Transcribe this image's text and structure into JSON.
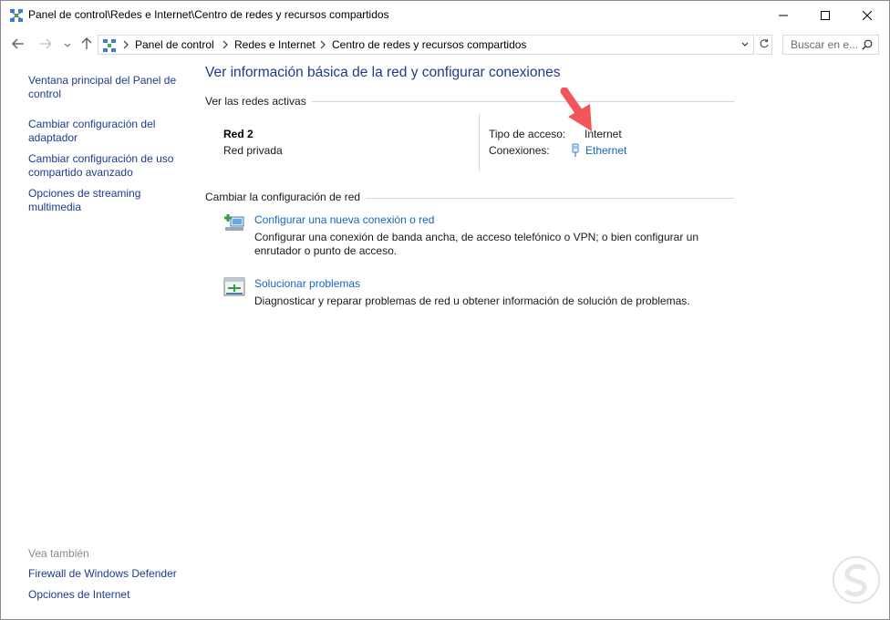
{
  "window": {
    "title": "Panel de control\\Redes e Internet\\Centro de redes y recursos compartidos",
    "controls": [
      "minimize-icon",
      "maximize-icon",
      "close-icon"
    ]
  },
  "address": {
    "breadcrumbs": [
      "Panel de control",
      "Redes e Internet",
      "Centro de redes y recursos compartidos"
    ],
    "search_placeholder": "Buscar en e..."
  },
  "sidebar": {
    "links": [
      "Ventana principal del Panel de control",
      "Cambiar configuración del adaptador",
      "Cambiar configuración de uso compartido avanzado",
      "Opciones de streaming multimedia"
    ],
    "see_also_label": "Vea también",
    "see_also_links": [
      "Firewall de Windows Defender",
      "Opciones de Internet"
    ]
  },
  "main": {
    "title": "Ver información básica de la red y configurar conexiones",
    "active_networks_heading": "Ver las redes activas",
    "network": {
      "name": "Red  2",
      "category": "Red privada",
      "access_type_label": "Tipo de acceso:",
      "access_type_value": "Internet",
      "connections_label": "Conexiones:",
      "connection_name": "Ethernet"
    },
    "change_settings_heading": "Cambiar la configuración de red",
    "tasks": [
      {
        "icon": "new-connection-icon",
        "title": "Configurar una nueva conexión o red",
        "description": "Configurar una conexión de banda ancha, de acceso telefónico o VPN; o bien configurar un enrutador o punto de acceso."
      },
      {
        "icon": "troubleshoot-icon",
        "title": "Solucionar problemas",
        "description": "Diagnosticar y reparar problemas de red u obtener información de solución de problemas."
      }
    ]
  },
  "colors": {
    "link": "#1565c0",
    "nav_link": "#1c3b8f",
    "title": "#1e3a8a",
    "arrow": "#f0565a"
  }
}
